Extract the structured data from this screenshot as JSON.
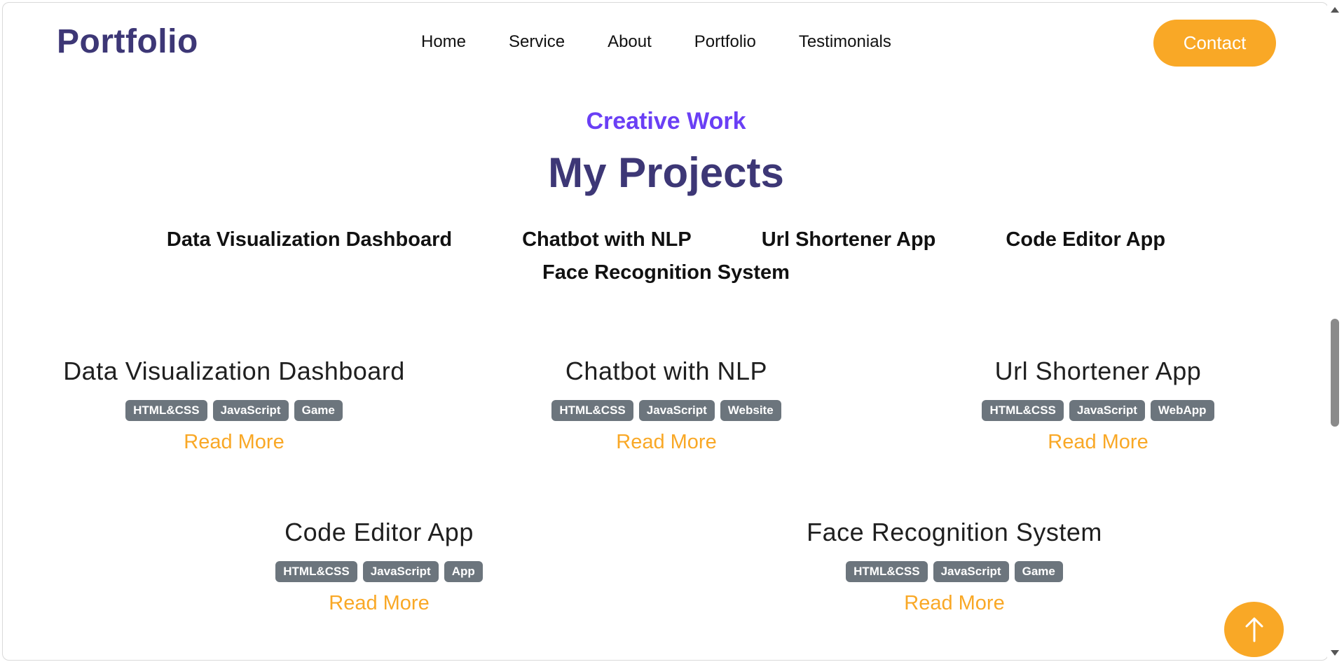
{
  "header": {
    "logo": "Portfolio",
    "nav": [
      "Home",
      "Service",
      "About",
      "Portfolio",
      "Testimonials"
    ],
    "contact_label": "Contact"
  },
  "section": {
    "subtitle": "Creative Work",
    "title": "My Projects"
  },
  "filters": [
    "Data Visualization Dashboard",
    "Chatbot with NLP",
    "Url Shortener App",
    "Code Editor App",
    "Face Recognition System"
  ],
  "projects": [
    {
      "title": "Data Visualization Dashboard",
      "tags": [
        "HTML&CSS",
        "JavaScript",
        "Game"
      ],
      "link": "Read More"
    },
    {
      "title": "Chatbot with NLP",
      "tags": [
        "HTML&CSS",
        "JavaScript",
        "Website"
      ],
      "link": "Read More"
    },
    {
      "title": "Url Shortener App",
      "tags": [
        "HTML&CSS",
        "JavaScript",
        "WebApp"
      ],
      "link": "Read More"
    },
    {
      "title": "Code Editor App",
      "tags": [
        "HTML&CSS",
        "JavaScript",
        "App"
      ],
      "link": "Read More"
    },
    {
      "title": "Face Recognition System",
      "tags": [
        "HTML&CSS",
        "JavaScript",
        "Game"
      ],
      "link": "Read More"
    }
  ],
  "scroll_top_icon": "arrow-up-icon",
  "colors": {
    "accent": "#f9a826",
    "brand": "#3d3776",
    "subtitle": "#6a3ff5",
    "tag_bg": "#6c757d"
  }
}
